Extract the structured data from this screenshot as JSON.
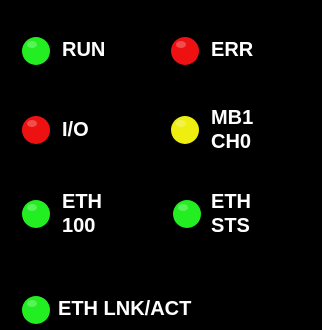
{
  "colors": {
    "panel_background": "#000000",
    "text": "#ffffff",
    "green": "#22ee22",
    "red": "#ee1111",
    "yellow": "#eeee11"
  },
  "indicators": [
    {
      "id": "run",
      "label_line1": "RUN",
      "label_line2": "",
      "color": "green"
    },
    {
      "id": "err",
      "label_line1": "ERR",
      "label_line2": "",
      "color": "red"
    },
    {
      "id": "io",
      "label_line1": "I/O",
      "label_line2": "",
      "color": "red"
    },
    {
      "id": "mb1-ch0",
      "label_line1": "MB1",
      "label_line2": "CH0",
      "color": "yellow"
    },
    {
      "id": "eth-100",
      "label_line1": "ETH",
      "label_line2": "100",
      "color": "green"
    },
    {
      "id": "eth-sts",
      "label_line1": "ETH",
      "label_line2": "STS",
      "color": "green"
    },
    {
      "id": "eth-lnk-act",
      "label_line1": "ETH LNK/ACT",
      "label_line2": "",
      "color": "green"
    }
  ]
}
